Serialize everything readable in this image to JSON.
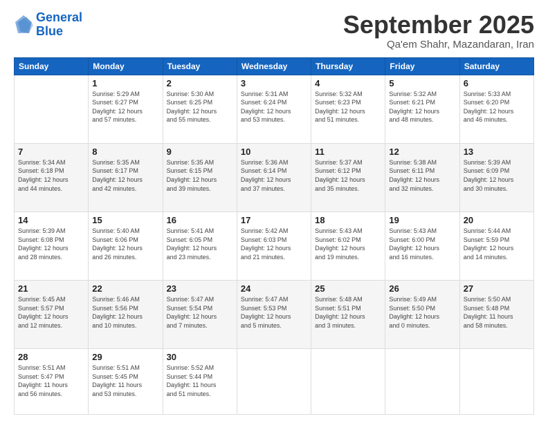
{
  "logo": {
    "line1": "General",
    "line2": "Blue"
  },
  "title": "September 2025",
  "subtitle": "Qa'em Shahr, Mazandaran, Iran",
  "weekdays": [
    "Sunday",
    "Monday",
    "Tuesday",
    "Wednesday",
    "Thursday",
    "Friday",
    "Saturday"
  ],
  "weeks": [
    [
      {
        "day": "",
        "text": ""
      },
      {
        "day": "1",
        "text": "Sunrise: 5:29 AM\nSunset: 6:27 PM\nDaylight: 12 hours\nand 57 minutes."
      },
      {
        "day": "2",
        "text": "Sunrise: 5:30 AM\nSunset: 6:25 PM\nDaylight: 12 hours\nand 55 minutes."
      },
      {
        "day": "3",
        "text": "Sunrise: 5:31 AM\nSunset: 6:24 PM\nDaylight: 12 hours\nand 53 minutes."
      },
      {
        "day": "4",
        "text": "Sunrise: 5:32 AM\nSunset: 6:23 PM\nDaylight: 12 hours\nand 51 minutes."
      },
      {
        "day": "5",
        "text": "Sunrise: 5:32 AM\nSunset: 6:21 PM\nDaylight: 12 hours\nand 48 minutes."
      },
      {
        "day": "6",
        "text": "Sunrise: 5:33 AM\nSunset: 6:20 PM\nDaylight: 12 hours\nand 46 minutes."
      }
    ],
    [
      {
        "day": "7",
        "text": "Sunrise: 5:34 AM\nSunset: 6:18 PM\nDaylight: 12 hours\nand 44 minutes."
      },
      {
        "day": "8",
        "text": "Sunrise: 5:35 AM\nSunset: 6:17 PM\nDaylight: 12 hours\nand 42 minutes."
      },
      {
        "day": "9",
        "text": "Sunrise: 5:35 AM\nSunset: 6:15 PM\nDaylight: 12 hours\nand 39 minutes."
      },
      {
        "day": "10",
        "text": "Sunrise: 5:36 AM\nSunset: 6:14 PM\nDaylight: 12 hours\nand 37 minutes."
      },
      {
        "day": "11",
        "text": "Sunrise: 5:37 AM\nSunset: 6:12 PM\nDaylight: 12 hours\nand 35 minutes."
      },
      {
        "day": "12",
        "text": "Sunrise: 5:38 AM\nSunset: 6:11 PM\nDaylight: 12 hours\nand 32 minutes."
      },
      {
        "day": "13",
        "text": "Sunrise: 5:39 AM\nSunset: 6:09 PM\nDaylight: 12 hours\nand 30 minutes."
      }
    ],
    [
      {
        "day": "14",
        "text": "Sunrise: 5:39 AM\nSunset: 6:08 PM\nDaylight: 12 hours\nand 28 minutes."
      },
      {
        "day": "15",
        "text": "Sunrise: 5:40 AM\nSunset: 6:06 PM\nDaylight: 12 hours\nand 26 minutes."
      },
      {
        "day": "16",
        "text": "Sunrise: 5:41 AM\nSunset: 6:05 PM\nDaylight: 12 hours\nand 23 minutes."
      },
      {
        "day": "17",
        "text": "Sunrise: 5:42 AM\nSunset: 6:03 PM\nDaylight: 12 hours\nand 21 minutes."
      },
      {
        "day": "18",
        "text": "Sunrise: 5:43 AM\nSunset: 6:02 PM\nDaylight: 12 hours\nand 19 minutes."
      },
      {
        "day": "19",
        "text": "Sunrise: 5:43 AM\nSunset: 6:00 PM\nDaylight: 12 hours\nand 16 minutes."
      },
      {
        "day": "20",
        "text": "Sunrise: 5:44 AM\nSunset: 5:59 PM\nDaylight: 12 hours\nand 14 minutes."
      }
    ],
    [
      {
        "day": "21",
        "text": "Sunrise: 5:45 AM\nSunset: 5:57 PM\nDaylight: 12 hours\nand 12 minutes."
      },
      {
        "day": "22",
        "text": "Sunrise: 5:46 AM\nSunset: 5:56 PM\nDaylight: 12 hours\nand 10 minutes."
      },
      {
        "day": "23",
        "text": "Sunrise: 5:47 AM\nSunset: 5:54 PM\nDaylight: 12 hours\nand 7 minutes."
      },
      {
        "day": "24",
        "text": "Sunrise: 5:47 AM\nSunset: 5:53 PM\nDaylight: 12 hours\nand 5 minutes."
      },
      {
        "day": "25",
        "text": "Sunrise: 5:48 AM\nSunset: 5:51 PM\nDaylight: 12 hours\nand 3 minutes."
      },
      {
        "day": "26",
        "text": "Sunrise: 5:49 AM\nSunset: 5:50 PM\nDaylight: 12 hours\nand 0 minutes."
      },
      {
        "day": "27",
        "text": "Sunrise: 5:50 AM\nSunset: 5:48 PM\nDaylight: 11 hours\nand 58 minutes."
      }
    ],
    [
      {
        "day": "28",
        "text": "Sunrise: 5:51 AM\nSunset: 5:47 PM\nDaylight: 11 hours\nand 56 minutes."
      },
      {
        "day": "29",
        "text": "Sunrise: 5:51 AM\nSunset: 5:45 PM\nDaylight: 11 hours\nand 53 minutes."
      },
      {
        "day": "30",
        "text": "Sunrise: 5:52 AM\nSunset: 5:44 PM\nDaylight: 11 hours\nand 51 minutes."
      },
      {
        "day": "",
        "text": ""
      },
      {
        "day": "",
        "text": ""
      },
      {
        "day": "",
        "text": ""
      },
      {
        "day": "",
        "text": ""
      }
    ]
  ]
}
